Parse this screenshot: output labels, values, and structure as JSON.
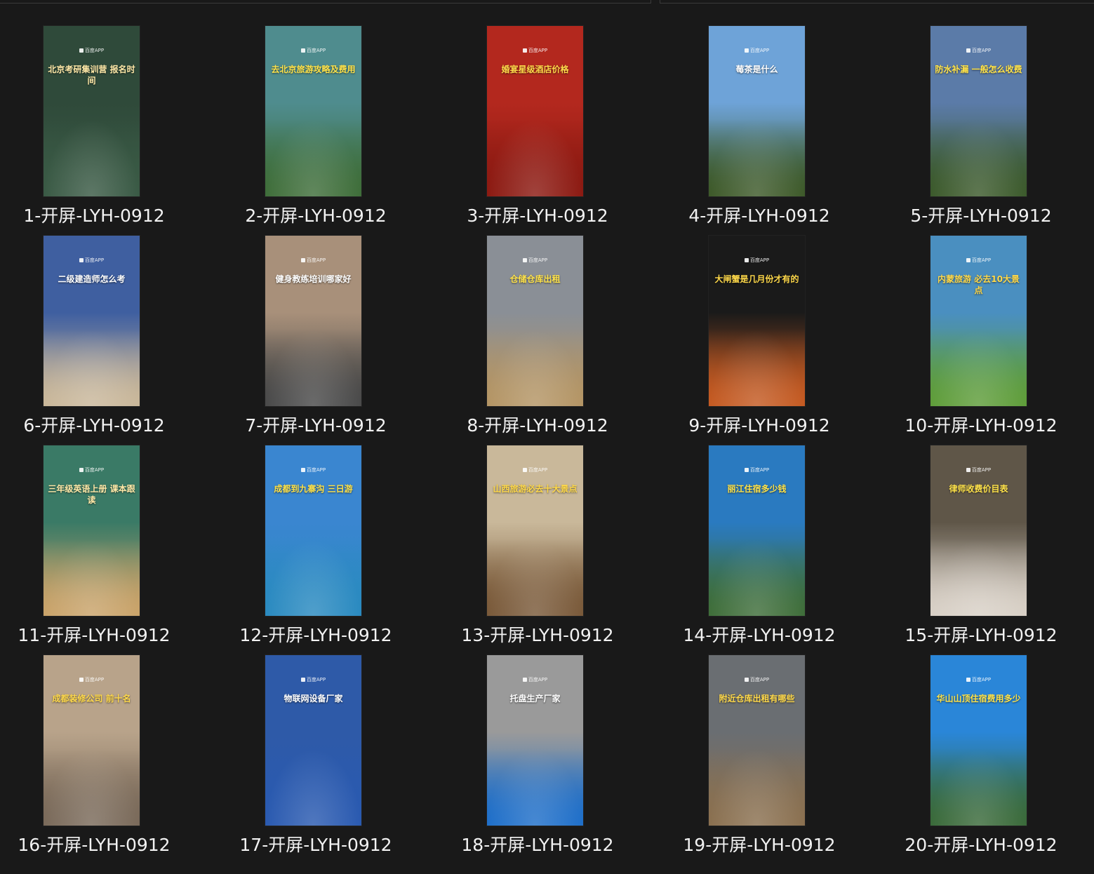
{
  "files": [
    {
      "name": "1-开屏-LYH-0912",
      "app": "百度APP",
      "headline": "北京考研集训营 报名时间"
    },
    {
      "name": "2-开屏-LYH-0912",
      "app": "百度APP",
      "headline": "去北京旅游攻略及费用"
    },
    {
      "name": "3-开屏-LYH-0912",
      "app": "百度APP",
      "headline": "婚宴星级酒店价格"
    },
    {
      "name": "4-开屏-LYH-0912",
      "app": "百度APP",
      "headline": "莓茶是什么"
    },
    {
      "name": "5-开屏-LYH-0912",
      "app": "百度APP",
      "headline": "防水补漏 一般怎么收费"
    },
    {
      "name": "6-开屏-LYH-0912",
      "app": "百度APP",
      "headline": "二级建造师怎么考"
    },
    {
      "name": "7-开屏-LYH-0912",
      "app": "百度APP",
      "headline": "健身教练培训哪家好"
    },
    {
      "name": "8-开屏-LYH-0912",
      "app": "百度APP",
      "headline": "仓储仓库出租"
    },
    {
      "name": "9-开屏-LYH-0912",
      "app": "百度APP",
      "headline": "大闸蟹是几月份才有的"
    },
    {
      "name": "10-开屏-LYH-0912",
      "app": "百度APP",
      "headline": "内蒙旅游 必去10大景点"
    },
    {
      "name": "11-开屏-LYH-0912",
      "app": "百度APP",
      "headline": "三年级英语上册 课本跟读"
    },
    {
      "name": "12-开屏-LYH-0912",
      "app": "百度APP",
      "headline": "成都到九寨沟 三日游"
    },
    {
      "name": "13-开屏-LYH-0912",
      "app": "百度APP",
      "headline": "山西旅游必去十大景点"
    },
    {
      "name": "14-开屏-LYH-0912",
      "app": "百度APP",
      "headline": "丽江住宿多少钱"
    },
    {
      "name": "15-开屏-LYH-0912",
      "app": "百度APP",
      "headline": "律师收费价目表"
    },
    {
      "name": "16-开屏-LYH-0912",
      "app": "百度APP",
      "headline": "成都装修公司 前十名"
    },
    {
      "name": "17-开屏-LYH-0912",
      "app": "百度APP",
      "headline": "物联网设备厂家"
    },
    {
      "name": "18-开屏-LYH-0912",
      "app": "百度APP",
      "headline": "托盘生产厂家"
    },
    {
      "name": "19-开屏-LYH-0912",
      "app": "百度APP",
      "headline": "附近仓库出租有哪些"
    },
    {
      "name": "20-开屏-LYH-0912",
      "app": "百度APP",
      "headline": "华山山顶住宿费用多少"
    }
  ],
  "thumb_colors": [
    {
      "bg": "#2f4a3a",
      "bottom": "#3a5a45",
      "text": "#ffe9a8"
    },
    {
      "bg": "#4f8c8e",
      "bottom": "#3f6e3a",
      "text": "#ffe34a"
    },
    {
      "bg": "#b3281e",
      "bottom": "#8c1a12",
      "text": "#ffd94a"
    },
    {
      "bg": "#6ea3d8",
      "bottom": "#3e5a2a",
      "text": "#ffffff"
    },
    {
      "bg": "#5b7ba8",
      "bottom": "#3c5a2c",
      "text": "#ffe34a"
    },
    {
      "bg": "#3f5fa0",
      "bottom": "#c9b79a",
      "text": "#ffffff"
    },
    {
      "bg": "#a8907a",
      "bottom": "#4a4a4a",
      "text": "#ffffff"
    },
    {
      "bg": "#8a8f96",
      "bottom": "#b49565",
      "text": "#ffe34a"
    },
    {
      "bg": "#1a1a1a",
      "bottom": "#c45a22",
      "text": "#ffd94a"
    },
    {
      "bg": "#4a8fc0",
      "bottom": "#5f9d3a",
      "text": "#ffd94a"
    },
    {
      "bg": "#3a7a66",
      "bottom": "#c9a36a",
      "text": "#ffe9a8"
    },
    {
      "bg": "#3a86d0",
      "bottom": "#2a8ac0",
      "text": "#ffe34a"
    },
    {
      "bg": "#c9b89a",
      "bottom": "#7a5a3a",
      "text": "#ffd94a"
    },
    {
      "bg": "#2a7ac0",
      "bottom": "#3f6e3a",
      "text": "#ffe34a"
    },
    {
      "bg": "#5f5648",
      "bottom": "#d8d0c6",
      "text": "#ffe34a"
    },
    {
      "bg": "#b8a38a",
      "bottom": "#7a6a5a",
      "text": "#ffd94a"
    },
    {
      "bg": "#2e5aa8",
      "bottom": "#2a5ab0",
      "text": "#ffffff"
    },
    {
      "bg": "#9a9a9a",
      "bottom": "#1f6fc9",
      "text": "#ffffff"
    },
    {
      "bg": "#6a6e72",
      "bottom": "#8a7050",
      "text": "#ffd94a"
    },
    {
      "bg": "#2a86d8",
      "bottom": "#3a6a3a",
      "text": "#ffe34a"
    }
  ]
}
